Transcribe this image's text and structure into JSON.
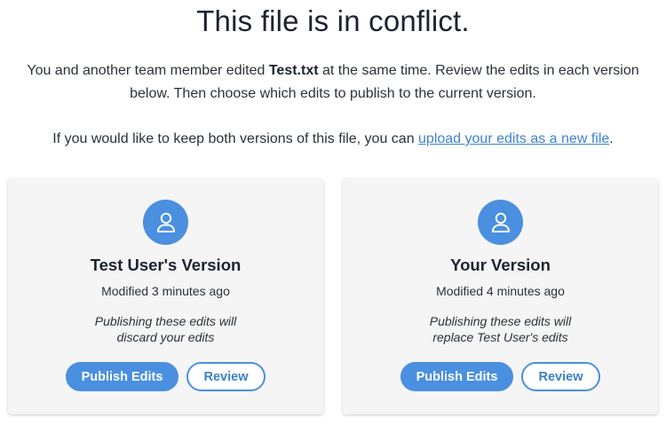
{
  "heading": "This file is in conflict.",
  "intro": {
    "before": "You and another team member edited ",
    "filename": "Test.txt",
    "after": " at the same time. Review the edits in each version below. Then choose which edits to publish to the current version."
  },
  "keep_both": {
    "before": "If you would like to keep both versions of this file, you can ",
    "link": "upload your edits as a new file",
    "after": "."
  },
  "colors": {
    "accent": "#4a8fe0",
    "link": "#3d84c9",
    "card_background": "#f5f5f5"
  },
  "versions": [
    {
      "avatar_icon": "user-icon",
      "title": "Test User's Version",
      "modified": "Modified 3 minutes ago",
      "warning_line1": "Publishing these edits will",
      "warning_line2": "discard your edits",
      "publish_label": "Publish Edits",
      "review_label": "Review"
    },
    {
      "avatar_icon": "user-icon",
      "title": "Your Version",
      "modified": "Modified 4 minutes ago",
      "warning_line1": "Publishing these edits will",
      "warning_line2": "replace Test User's edits",
      "publish_label": "Publish Edits",
      "review_label": "Review"
    }
  ]
}
